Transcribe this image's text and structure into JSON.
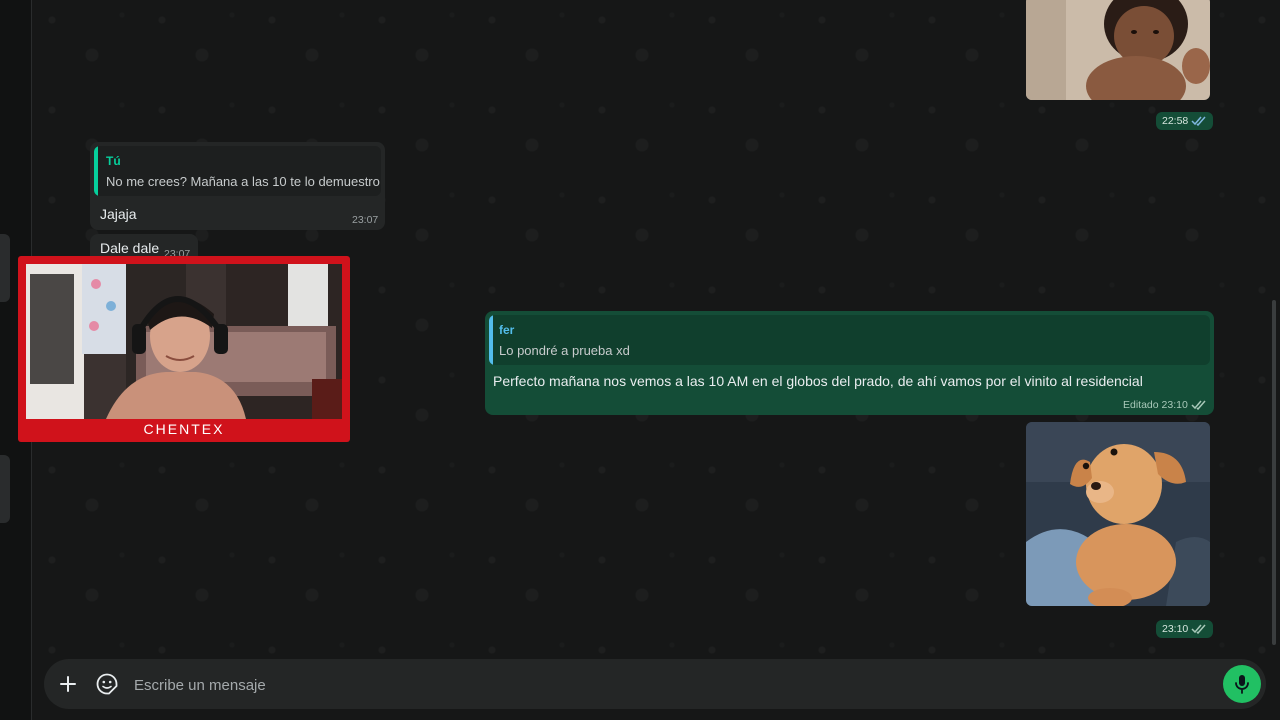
{
  "messages": {
    "baby_photo": {
      "time": "22:58"
    },
    "reply_in": {
      "quote_author": "Tú",
      "quote_text": "No me crees? Mañana a las 10 te lo demuestro",
      "text": "Jajaja",
      "time": "23:07"
    },
    "dale": {
      "text": "Dale dale",
      "time": "23:07"
    },
    "reply_out": {
      "quote_author": "fer",
      "quote_text": "Lo pondré a prueba xd",
      "text": "Perfecto mañana nos vemos a las 10 AM en el globos del prado, de ahí vamos por el vinito al residencial",
      "time": "Editado 23:10"
    },
    "dog_photo": {
      "time": "23:10"
    }
  },
  "webcam": {
    "name": "CHENTEX"
  },
  "composer": {
    "placeholder": "Escribe un mensaje"
  },
  "colors": {
    "background": "#161717",
    "incoming_bubble": "#242626",
    "outgoing_bubble": "#144d37",
    "accent_green": "#21c063",
    "quote_you": "#06cf9c",
    "quote_fer": "#53bdeb",
    "webcam_frame": "#d0121b"
  },
  "icons": [
    "plus-icon",
    "sticker-icon",
    "mic-icon",
    "double-check-icon"
  ]
}
